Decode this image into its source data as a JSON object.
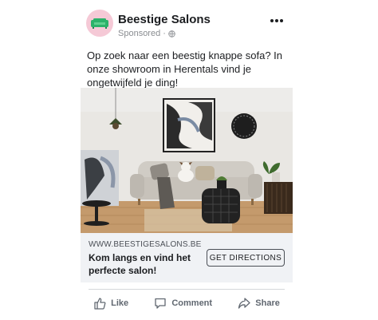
{
  "post": {
    "page_name": "Beestige Salons",
    "sponsored_label": "Sponsored",
    "caption": "Op zoek naar een beestig knappe sofa? In onze showroom in Herentals vind je ongetwijfeld je ding!"
  },
  "link_card": {
    "domain": "WWW.BEESTIGESALONS.BE",
    "headline": "Kom langs en vind het perfecte salon!",
    "cta_label": "GET DIRECTIONS"
  },
  "actions": {
    "like_label": "Like",
    "comment_label": "Comment",
    "share_label": "Share"
  },
  "icons": {
    "avatar": "sofa-logo-icon",
    "sponsored": "globe-icon",
    "menu": "more-dots-icon",
    "like": "thumbs-up-icon",
    "comment": "comment-icon",
    "share": "share-icon"
  },
  "colors": {
    "avatar_bg": "#f5c9d6",
    "logo_green": "#2bb36a",
    "card_bg": "#f0f2f5",
    "action_text": "#606770"
  }
}
